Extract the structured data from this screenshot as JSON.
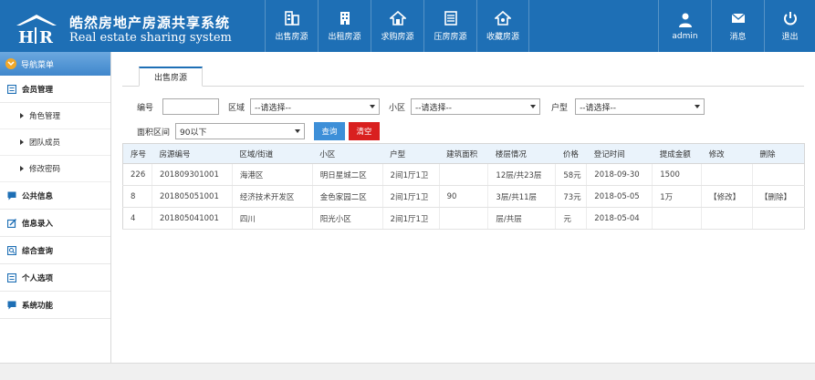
{
  "brand": {
    "title_cn": "皓然房地产房源共享系统",
    "title_en": "Real estate sharing system",
    "logo_letters": "H R"
  },
  "topnav": [
    {
      "label": "出售房源",
      "icon": "building-sale-icon"
    },
    {
      "label": "出租房源",
      "icon": "building-rent-icon"
    },
    {
      "label": "求购房源",
      "icon": "home-wanted-icon"
    },
    {
      "label": "压房房源",
      "icon": "document-icon"
    },
    {
      "label": "收藏房源",
      "icon": "home-favorite-icon"
    }
  ],
  "rightnav": [
    {
      "label": "admin",
      "icon": "user-icon"
    },
    {
      "label": "消息",
      "icon": "mail-icon"
    },
    {
      "label": "退出",
      "icon": "power-icon"
    }
  ],
  "sidebar": {
    "header": "导航菜单",
    "groups": [
      {
        "label": "会员管理",
        "icon": "list-icon"
      },
      {
        "label": "公共信息",
        "icon": "chat-icon"
      },
      {
        "label": "信息录入",
        "icon": "edit-icon"
      },
      {
        "label": "综合查询",
        "icon": "search-doc-icon"
      },
      {
        "label": "个人选项",
        "icon": "list-icon"
      },
      {
        "label": "系统功能",
        "icon": "chat-icon"
      }
    ],
    "subitems": [
      {
        "label": "角色管理"
      },
      {
        "label": "团队成员"
      },
      {
        "label": "修改密码"
      }
    ]
  },
  "main": {
    "tab": "出售房源",
    "filters": {
      "code_label": "编号",
      "code_value": "",
      "district_label": "区域",
      "district_value": "--请选择--",
      "community_label": "小区",
      "community_value": "--请选择--",
      "layout_label": "户型",
      "layout_value": "--请选择--",
      "area_label": "面积区间",
      "area_value": "90以下",
      "query_label": "查询",
      "clear_label": "清空"
    },
    "columns": [
      "序号",
      "房源编号",
      "区域/街道",
      "小区",
      "户型",
      "建筑面积",
      "楼层情况",
      "价格",
      "登记时间",
      "提成金额",
      "修改",
      "删除"
    ],
    "rows": [
      {
        "no": "226",
        "code": "201809301001",
        "district": "海港区",
        "community": "明日星城二区",
        "layout": "2间1厅1卫",
        "area": "",
        "floor": "12层/共23层",
        "price": "58元",
        "date": "2018-09-30",
        "commission": "1500",
        "edit": "",
        "del": ""
      },
      {
        "no": "8",
        "code": "201805051001",
        "district": "经济技术开发区",
        "community": "金色家园二区",
        "layout": "2间1厅1卫",
        "area": "90",
        "floor": "3层/共11层",
        "price": "73元",
        "date": "2018-05-05",
        "commission": "1万",
        "edit": "【修改】",
        "del": "【删除】"
      },
      {
        "no": "4",
        "code": "201805041001",
        "district": "四川",
        "community": "阳光小区",
        "layout": "2间1厅1卫",
        "area": "",
        "floor": "层/共层",
        "price": "元",
        "date": "2018-05-04",
        "commission": "",
        "edit": "",
        "del": ""
      }
    ]
  },
  "colors": {
    "header_bg": "#1e6fb5",
    "accent_orange": "#f1a82a",
    "query_button": "#3d8fd8",
    "clear_button": "#d9201f",
    "link": "#2a6fb8"
  }
}
